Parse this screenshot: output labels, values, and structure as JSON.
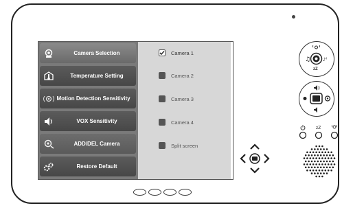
{
  "menu": {
    "items": [
      {
        "label": "Camera Selection",
        "icon": "camera-icon",
        "selected": true
      },
      {
        "label": "Temperature Setting",
        "icon": "thermometer-icon",
        "selected": false
      },
      {
        "label": "Motion Detection Sensitivity",
        "icon": "motion-icon",
        "selected": false
      },
      {
        "label": "VOX Sensitivity",
        "icon": "sound-icon",
        "selected": false
      },
      {
        "label": "ADD/DEL Camera",
        "icon": "add-camera-icon",
        "selected": false
      },
      {
        "label": "Restore Default",
        "icon": "gears-icon",
        "selected": false
      }
    ]
  },
  "submenu": {
    "options": [
      {
        "label": "Camera 1",
        "checked": true
      },
      {
        "label": "Camera 2",
        "checked": false
      },
      {
        "label": "Camera 3",
        "checked": false
      },
      {
        "label": "Camera 4",
        "checked": false
      },
      {
        "label": "Split screen",
        "checked": false
      }
    ]
  },
  "controls": {
    "top_dial_label": "zZ",
    "side_label_small": "zZ"
  },
  "colors": {
    "menu_dark": "#4e4e4e",
    "menu_selected": "#7a7a7a",
    "submenu_bg": "#d7d7d7"
  }
}
